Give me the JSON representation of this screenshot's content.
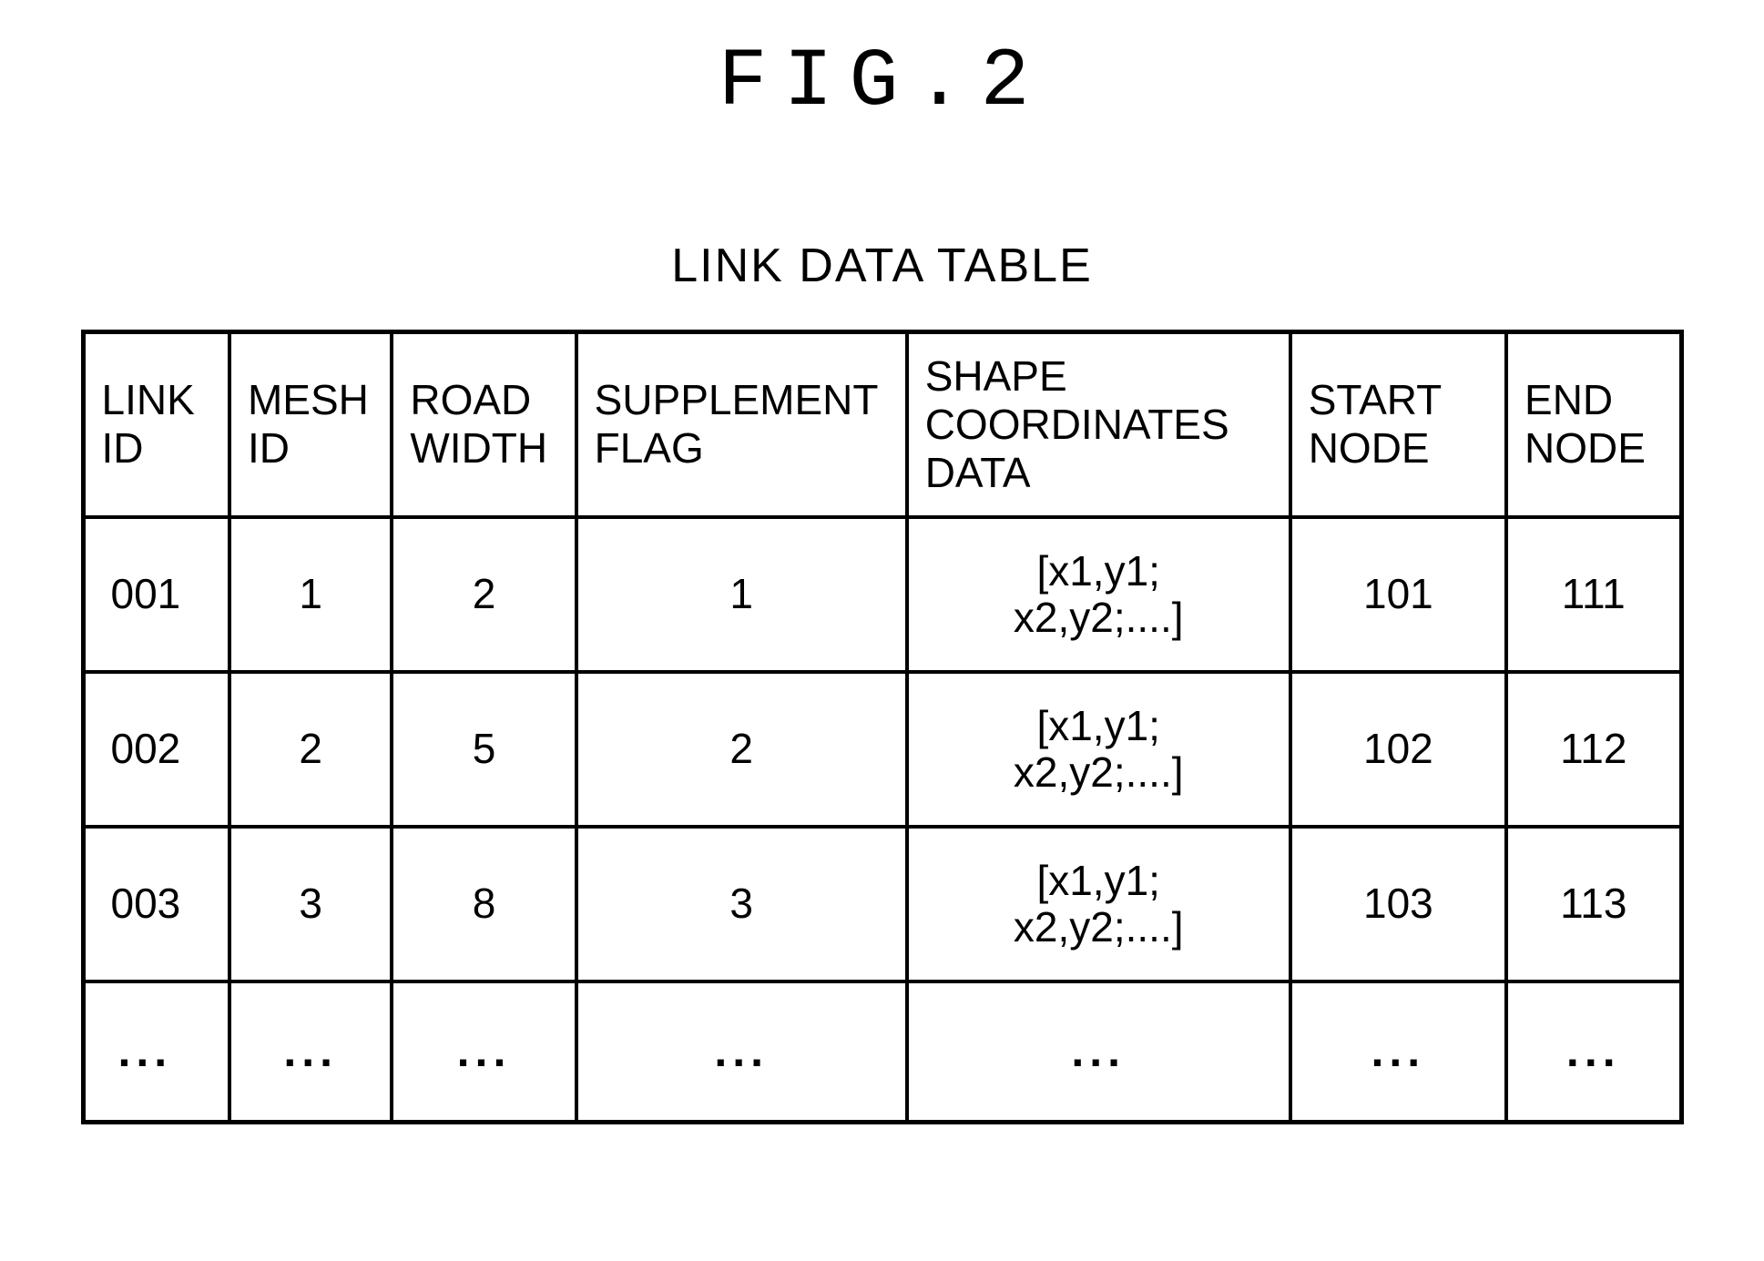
{
  "figure_title": "FIG.2",
  "table_caption": "LINK DATA TABLE",
  "headers": {
    "link_id": "LINK\nID",
    "mesh_id": "MESH\nID",
    "road_width": "ROAD\nWIDTH",
    "supplement_flag": "SUPPLEMENT\nFLAG",
    "shape_coords": "SHAPE\nCOORDINATES\nDATA",
    "start_node": "START\nNODE",
    "end_node": "END\nNODE"
  },
  "rows": [
    {
      "link_id": "001",
      "mesh_id": "1",
      "road_width": "2",
      "supplement_flag": "1",
      "shape_coords": "[x1,y1;\nx2,y2;....]",
      "start_node": "101",
      "end_node": "111"
    },
    {
      "link_id": "002",
      "mesh_id": "2",
      "road_width": "5",
      "supplement_flag": "2",
      "shape_coords": "[x1,y1;\nx2,y2;....]",
      "start_node": "102",
      "end_node": "112"
    },
    {
      "link_id": "003",
      "mesh_id": "3",
      "road_width": "8",
      "supplement_flag": "3",
      "shape_coords": "[x1,y1;\nx2,y2;....]",
      "start_node": "103",
      "end_node": "113"
    }
  ],
  "ellipsis": "...",
  "chart_data": {
    "type": "table",
    "title": "LINK DATA TABLE",
    "columns": [
      "LINK ID",
      "MESH ID",
      "ROAD WIDTH",
      "SUPPLEMENT FLAG",
      "SHAPE COORDINATES DATA",
      "START NODE",
      "END NODE"
    ],
    "rows": [
      [
        "001",
        "1",
        "2",
        "1",
        "[x1,y1; x2,y2;....]",
        "101",
        "111"
      ],
      [
        "002",
        "2",
        "5",
        "2",
        "[x1,y1; x2,y2;....]",
        "102",
        "112"
      ],
      [
        "003",
        "3",
        "8",
        "3",
        "[x1,y1; x2,y2;....]",
        "103",
        "113"
      ],
      [
        "...",
        "...",
        "...",
        "...",
        "...",
        "...",
        "..."
      ]
    ]
  }
}
